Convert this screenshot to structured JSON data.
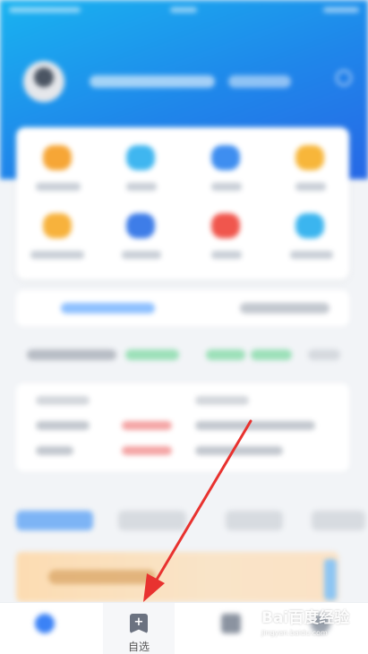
{
  "colors": {
    "header_start": "#19b3f0",
    "header_end": "#2768e6",
    "arrow": "#e8322f",
    "tabbar_active_icon": "#3b82f6"
  },
  "tabbar": {
    "items": [
      {
        "label": "",
        "icon": "home-icon"
      },
      {
        "label": "自选",
        "icon": "bookmark-plus-icon"
      },
      {
        "label": "",
        "icon": "market-icon"
      },
      {
        "label": "",
        "icon": "profile-icon"
      }
    ]
  },
  "watermark": {
    "logo_text": "Bai百度经验",
    "url": "jingyan.baidu.com"
  }
}
